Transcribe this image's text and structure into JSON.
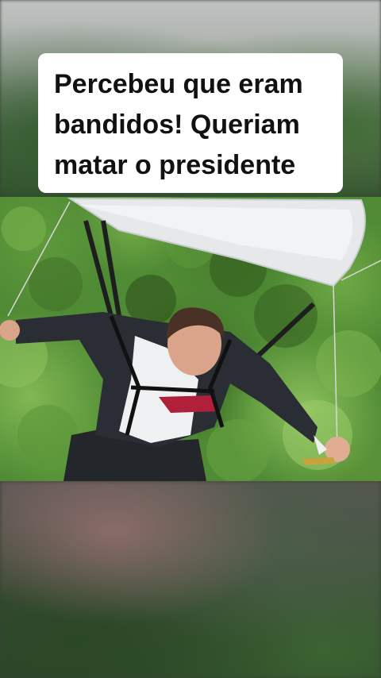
{
  "caption": {
    "lines": [
      "Percebeu que eram",
      "bandidos! Queriam",
      "matar o presidente"
    ]
  },
  "colors": {
    "caption_bg": "#ffffff",
    "caption_text": "#111111",
    "foliage": "#4f8a34"
  },
  "icons": {
    "photo": "man-in-suit-hanging-from-parachute-over-forest"
  }
}
